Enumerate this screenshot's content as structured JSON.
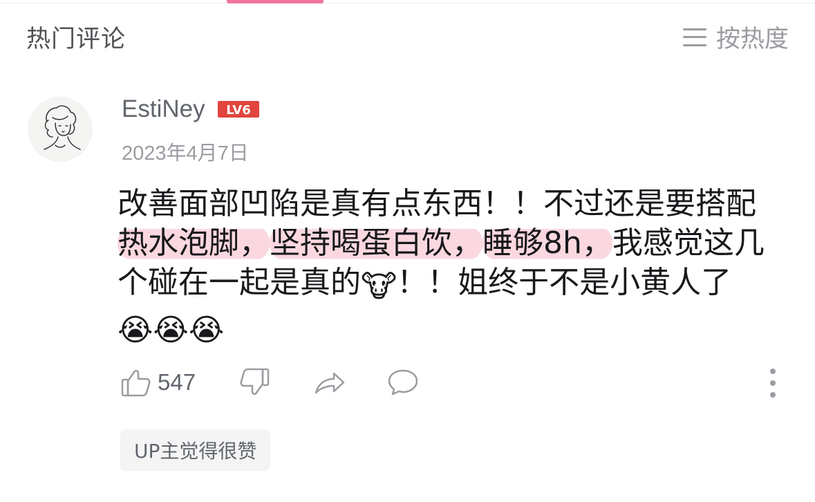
{
  "header": {
    "title": "热门评论",
    "sort_label": "按热度"
  },
  "comment": {
    "username": "EstiNey",
    "level": "LV6",
    "date": "2023年4月7日",
    "text": {
      "p1": "改善面部凹陷是真有点东西！！不过还是要搭配",
      "h1": "热水泡脚，",
      "h2": "坚持喝蛋白饮，",
      "h3": "睡够8h，",
      "p2": "我感觉这几个碰在一起是真的",
      "p3": "！！姐终于不是小黄人了",
      "emoji_cow": "🐮",
      "emoji_cry": "😭😭😭"
    },
    "like_count": "547",
    "up_tag": "UP主觉得很赞"
  },
  "colors": {
    "accent": "#f0739a",
    "highlight": "#fbd8df",
    "level_badge": "#e1453d"
  }
}
